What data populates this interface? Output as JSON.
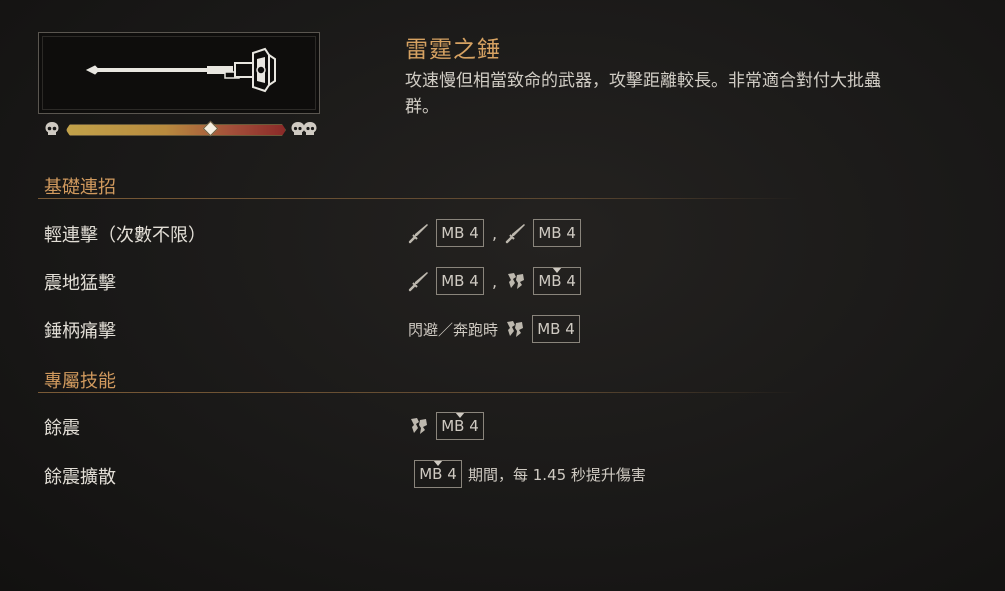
{
  "weapon": {
    "name": "雷霆之錘",
    "description": "攻速慢但相當致命的武器，攻擊距離較長。非常適合對付大批蟲群。",
    "attack_speed_fraction": 0.66,
    "icon": "warhammer-icon"
  },
  "speed_bar": {
    "slow_icon": "skull-icon",
    "fast_icon": "double-skull-icon",
    "colors": [
      "#c2a24a",
      "#8a2a28"
    ]
  },
  "sections": {
    "basic_combos": {
      "title": "基礎連招",
      "moves": [
        {
          "name": "輕連擊（次數不限）",
          "inputs": [
            {
              "icon": "sword-icon",
              "key": "MB 4"
            },
            {
              "sep": ","
            },
            {
              "icon": "sword-icon",
              "key": "MB 4"
            }
          ]
        },
        {
          "name": "震地猛擊",
          "inputs": [
            {
              "icon": "sword-icon",
              "key": "MB 4"
            },
            {
              "sep": ","
            },
            {
              "icon": "heavy-strike-icon",
              "key": "MB 4",
              "hold": true
            }
          ]
        },
        {
          "name": "錘柄痛擊",
          "inputs": [
            {
              "text": "閃避／奔跑時"
            },
            {
              "icon": "heavy-strike-icon",
              "key": "MB 4"
            }
          ]
        }
      ]
    },
    "special_skills": {
      "title": "專屬技能",
      "moves": [
        {
          "name": "餘震",
          "inputs": [
            {
              "icon": "heavy-strike-icon",
              "key": "MB 4",
              "hold": true
            }
          ]
        },
        {
          "name": "餘震擴散",
          "inputs": [
            {
              "key": "MB 4",
              "hold": true
            },
            {
              "text": "期間，每 1.45 秒提升傷害"
            }
          ]
        }
      ]
    }
  },
  "colors": {
    "accent": "#d6a262",
    "section": "#d19a5e",
    "text": "#e2ded6"
  }
}
